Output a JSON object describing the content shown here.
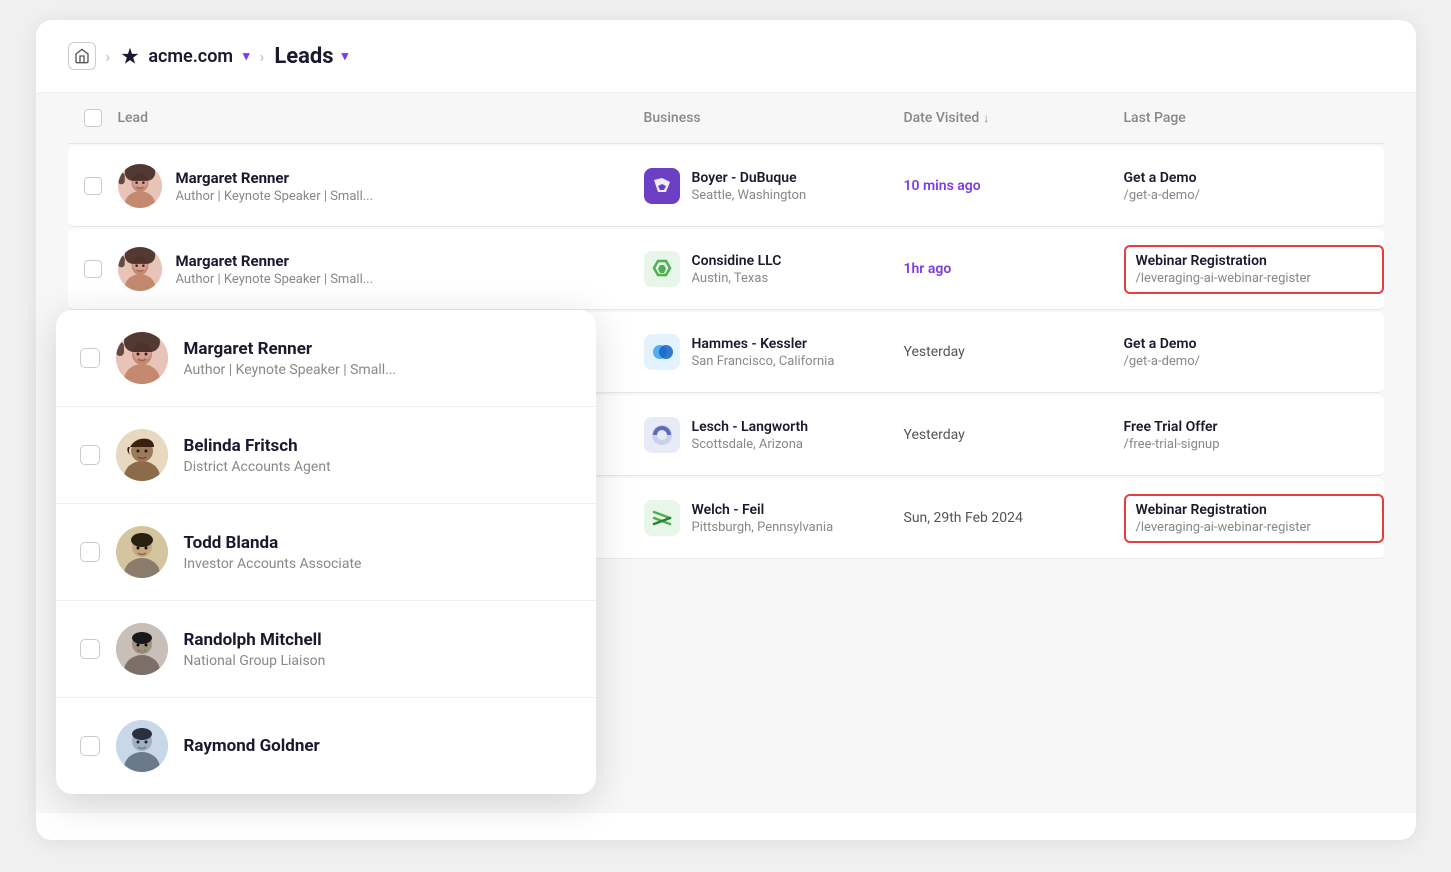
{
  "breadcrumb": {
    "home_label": "🏠",
    "sep": ">",
    "acme_label": "acme.com",
    "acme_dropdown": "▾",
    "leads_label": "Leads",
    "leads_dropdown": "▾"
  },
  "table": {
    "columns": [
      {
        "key": "checkbox",
        "label": ""
      },
      {
        "key": "lead",
        "label": "Lead"
      },
      {
        "key": "business",
        "label": "Business"
      },
      {
        "key": "date_visited",
        "label": "Date Visited",
        "sortable": true
      },
      {
        "key": "last_page",
        "label": "Last Page"
      }
    ],
    "rows": [
      {
        "id": "margaret-renner",
        "name": "Margaret Renner",
        "title": "Author | Keynote Speaker | Small...",
        "business_name": "Boyer - DuBuque",
        "business_location": "Seattle, Washington",
        "date_visited": "10 mins ago",
        "date_highlight": true,
        "last_page_name": "Get a Demo",
        "last_page_url": "/get-a-demo/",
        "last_page_highlighted": false,
        "avatar_class": "avatar-margaret"
      },
      {
        "id": "margaret-renner-2",
        "name": "Margaret Renner",
        "title": "Author | Keynote Speaker | Small...",
        "business_name": "Considine LLC",
        "business_location": "Austin, Texas",
        "date_visited": "1hr ago",
        "date_highlight": true,
        "last_page_name": "Webinar Registration",
        "last_page_url": "/leveraging-ai-webinar-register",
        "last_page_highlighted": true,
        "avatar_class": "avatar-margaret"
      },
      {
        "id": "belinda-fritsch",
        "name": "Belinda Fritsch",
        "title": "District Accounts Agent",
        "business_name": "Hammes - Kessler",
        "business_location": "San Francisco, California",
        "date_visited": "Yesterday",
        "date_highlight": false,
        "last_page_name": "Get a Demo",
        "last_page_url": "/get-a-demo/",
        "last_page_highlighted": false,
        "avatar_class": "avatar-belinda"
      },
      {
        "id": "todd-blanda",
        "name": "Todd Blanda",
        "title": "Investor Accounts Associate",
        "business_name": "Lesch - Langworth",
        "business_location": "Scottsdale, Arizona",
        "date_visited": "Yesterday",
        "date_highlight": false,
        "last_page_name": "Free Trial Offer",
        "last_page_url": "/free-trial-signup",
        "last_page_highlighted": false,
        "avatar_class": "avatar-todd"
      },
      {
        "id": "randolph-mitchell",
        "name": "Randolph Mitchell",
        "title": "National Group Liaison",
        "business_name": "Welch - Feil",
        "business_location": "Pittsburgh, Pennsylvania",
        "date_visited": "Sun, 29th Feb 2024",
        "date_highlight": false,
        "last_page_name": "Webinar Registration",
        "last_page_url": "/leveraging-ai-webinar-register",
        "last_page_highlighted": true,
        "avatar_class": "avatar-randolph"
      }
    ]
  },
  "panel": {
    "rows": [
      {
        "id": "panel-margaret",
        "name": "Margaret Renner",
        "title": "Author | Keynote Speaker | Small...",
        "avatar_class": "avatar-margaret"
      },
      {
        "id": "panel-belinda",
        "name": "Belinda Fritsch",
        "title": "District Accounts Agent",
        "avatar_class": "avatar-belinda"
      },
      {
        "id": "panel-todd",
        "name": "Todd Blanda",
        "title": "Investor Accounts Associate",
        "avatar_class": "avatar-todd"
      },
      {
        "id": "panel-randolph",
        "name": "Randolph Mitchell",
        "title": "National Group Liaison",
        "avatar_class": "avatar-randolph"
      },
      {
        "id": "panel-raymond",
        "name": "Raymond Goldner",
        "title": "",
        "avatar_class": "avatar-raymond"
      }
    ]
  },
  "business_logos": {
    "boyer": {
      "symbol": "⬟",
      "bg": "#6c3fc5",
      "color": "#fff"
    },
    "considine": {
      "symbol": "⚡⚡",
      "bg": "#e8f5e9",
      "color": "#4caf50"
    },
    "hammes": {
      "symbol": "●●",
      "bg": "#e3f2fd",
      "color": "#2196f3"
    },
    "lesch": {
      "symbol": "◑",
      "bg": "#e8eaf6",
      "color": "#5c6bc0"
    },
    "welch": {
      "symbol": "≋",
      "bg": "#e8f5e9",
      "color": "#4caf50"
    }
  }
}
